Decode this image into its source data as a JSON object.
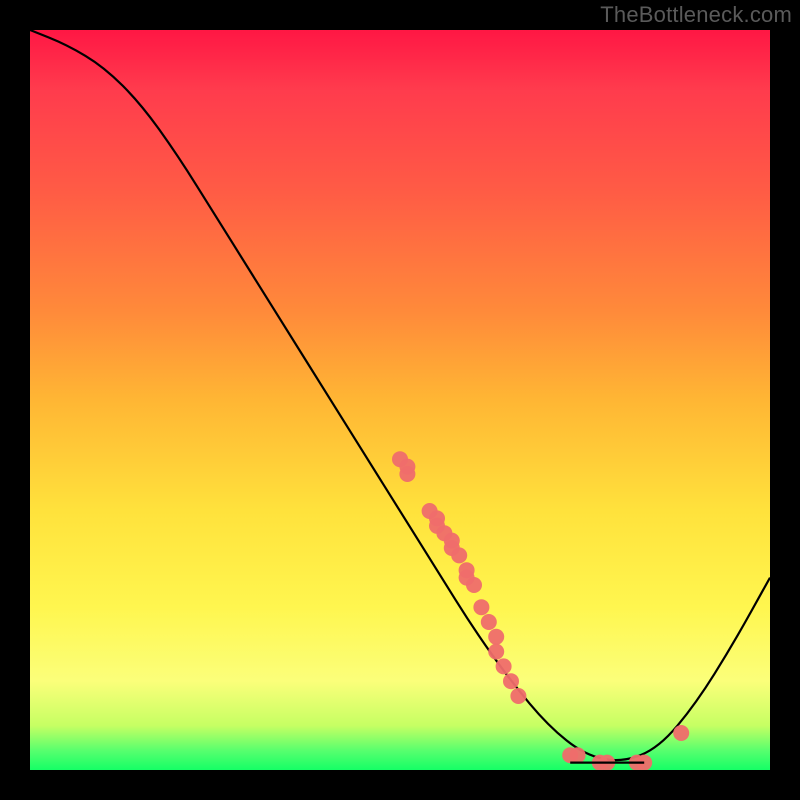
{
  "watermark": "TheBottleneck.com",
  "chart_data": {
    "type": "line",
    "title": "",
    "xlabel": "",
    "ylabel": "",
    "xlim": [
      0,
      100
    ],
    "ylim": [
      0,
      100
    ],
    "grid": false,
    "legend": false,
    "curve": [
      {
        "x": 0,
        "y": 100
      },
      {
        "x": 5,
        "y": 98
      },
      {
        "x": 10,
        "y": 95
      },
      {
        "x": 15,
        "y": 90
      },
      {
        "x": 20,
        "y": 83
      },
      {
        "x": 25,
        "y": 75
      },
      {
        "x": 30,
        "y": 67
      },
      {
        "x": 35,
        "y": 59
      },
      {
        "x": 40,
        "y": 51
      },
      {
        "x": 45,
        "y": 43
      },
      {
        "x": 50,
        "y": 35
      },
      {
        "x": 55,
        "y": 27
      },
      {
        "x": 60,
        "y": 19
      },
      {
        "x": 65,
        "y": 12
      },
      {
        "x": 70,
        "y": 6
      },
      {
        "x": 75,
        "y": 2
      },
      {
        "x": 80,
        "y": 1
      },
      {
        "x": 85,
        "y": 3
      },
      {
        "x": 90,
        "y": 9
      },
      {
        "x": 95,
        "y": 17
      },
      {
        "x": 100,
        "y": 26
      }
    ],
    "scatter_points": [
      {
        "x": 50,
        "y": 42
      },
      {
        "x": 51,
        "y": 41
      },
      {
        "x": 51,
        "y": 40
      },
      {
        "x": 54,
        "y": 35
      },
      {
        "x": 55,
        "y": 34
      },
      {
        "x": 55,
        "y": 33
      },
      {
        "x": 56,
        "y": 32
      },
      {
        "x": 57,
        "y": 31
      },
      {
        "x": 57,
        "y": 30
      },
      {
        "x": 58,
        "y": 29
      },
      {
        "x": 59,
        "y": 27
      },
      {
        "x": 59,
        "y": 26
      },
      {
        "x": 60,
        "y": 25
      },
      {
        "x": 61,
        "y": 22
      },
      {
        "x": 62,
        "y": 20
      },
      {
        "x": 63,
        "y": 18
      },
      {
        "x": 63,
        "y": 16
      },
      {
        "x": 64,
        "y": 14
      },
      {
        "x": 65,
        "y": 12
      },
      {
        "x": 66,
        "y": 10
      },
      {
        "x": 73,
        "y": 2
      },
      {
        "x": 74,
        "y": 2
      },
      {
        "x": 77,
        "y": 1
      },
      {
        "x": 78,
        "y": 1
      },
      {
        "x": 82,
        "y": 1
      },
      {
        "x": 83,
        "y": 1
      },
      {
        "x": 88,
        "y": 5
      }
    ],
    "plateau_segment": {
      "x1": 73,
      "x2": 83,
      "y": 1
    }
  }
}
